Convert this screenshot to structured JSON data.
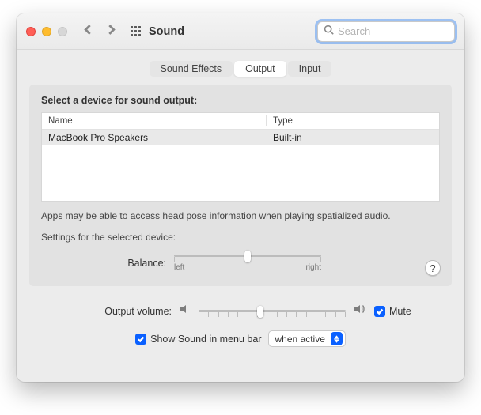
{
  "window": {
    "title": "Sound",
    "searchPlaceholder": "Search"
  },
  "tabs": {
    "effects": "Sound Effects",
    "output": "Output",
    "input": "Input",
    "active": "output"
  },
  "panel": {
    "heading": "Select a device for sound output:",
    "columns": {
      "name": "Name",
      "type": "Type"
    },
    "rows": [
      {
        "name": "MacBook Pro Speakers",
        "type": "Built-in"
      }
    ],
    "note": "Apps may be able to access head pose information when playing spatialized audio.",
    "settingsHeading": "Settings for the selected device:",
    "balanceLabel": "Balance:",
    "balanceLeft": "left",
    "balanceRight": "right",
    "help": "?"
  },
  "volume": {
    "label": "Output volume:",
    "muteLabel": "Mute",
    "muteChecked": true,
    "showLabel": "Show Sound in menu bar",
    "showChecked": true,
    "selectValue": "when active"
  }
}
